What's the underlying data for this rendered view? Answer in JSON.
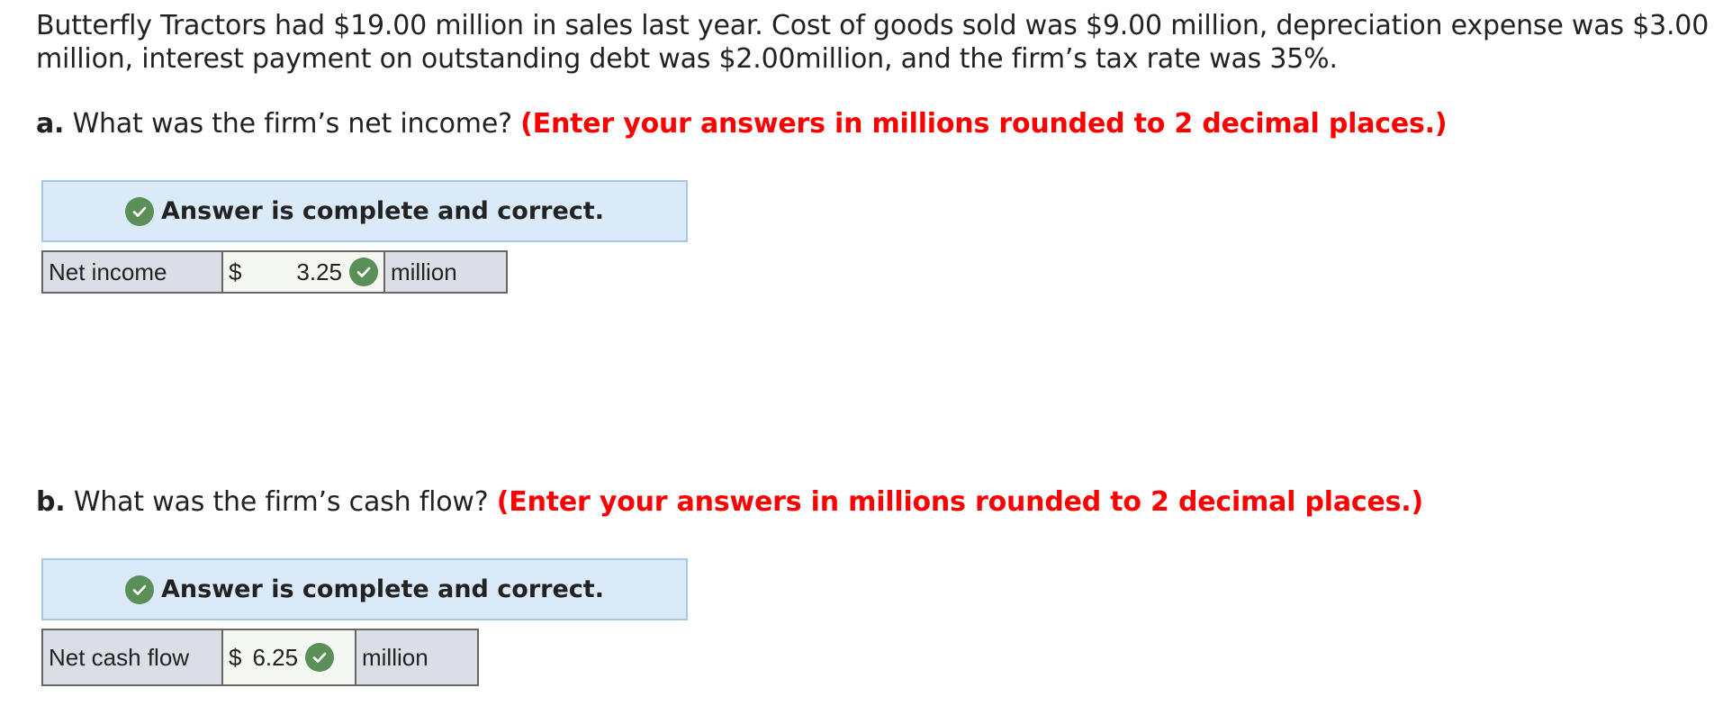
{
  "problem": {
    "intro": "Butterfly Tractors had $19.00 million in sales last year. Cost of goods sold was $9.00 million, depreciation expense was $3.00 million, interest payment on outstanding debt was $2.00million, and the firm’s tax rate was 35%."
  },
  "part_a": {
    "letter": "a.",
    "question": " What was the firm’s net income? ",
    "instruction": "(Enter your answers in millions rounded to 2 decimal places.)",
    "banner": "Answer is complete and correct.",
    "row": {
      "label": "Net income",
      "currency": "$",
      "value": "3.25",
      "unit": "million",
      "status_icon": "check-icon"
    }
  },
  "part_b": {
    "letter": "b.",
    "question": " What was the firm’s cash flow? ",
    "instruction": "(Enter your answers in millions rounded to 2 decimal places.)",
    "banner": "Answer is complete and correct.",
    "row": {
      "label": "Net cash flow",
      "currency": "$",
      "value": "6.25",
      "unit": "million",
      "status_icon": "check-icon"
    }
  },
  "colors": {
    "instruction": "#ff0000",
    "banner_bg": "#dbeaf8",
    "check_green": "#5b8f58",
    "label_cell_bg": "#dcdee6"
  }
}
